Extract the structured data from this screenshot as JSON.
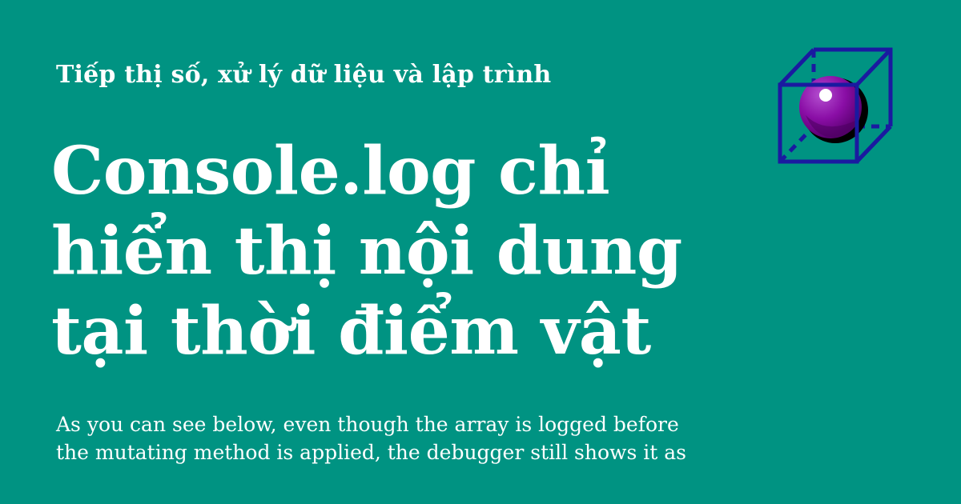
{
  "card": {
    "kicker": "Tiếp thị số, xử lý dữ liệu và lập trình",
    "headline_lines": [
      "Console.log chỉ",
      "hiển thị nội dung",
      "tại thời điểm vật"
    ],
    "excerpt_lines": [
      "As you can see below, even though the array is logged before",
      "the mutating method is applied, the debugger still shows it as"
    ],
    "logo_icon": "cube-with-sphere-icon"
  },
  "colors": {
    "background": "#009382",
    "text": "#ffffff",
    "cube_stroke": "#1a1aa0",
    "sphere": "#8a0ea6",
    "sphere_shadow": "#000000"
  }
}
